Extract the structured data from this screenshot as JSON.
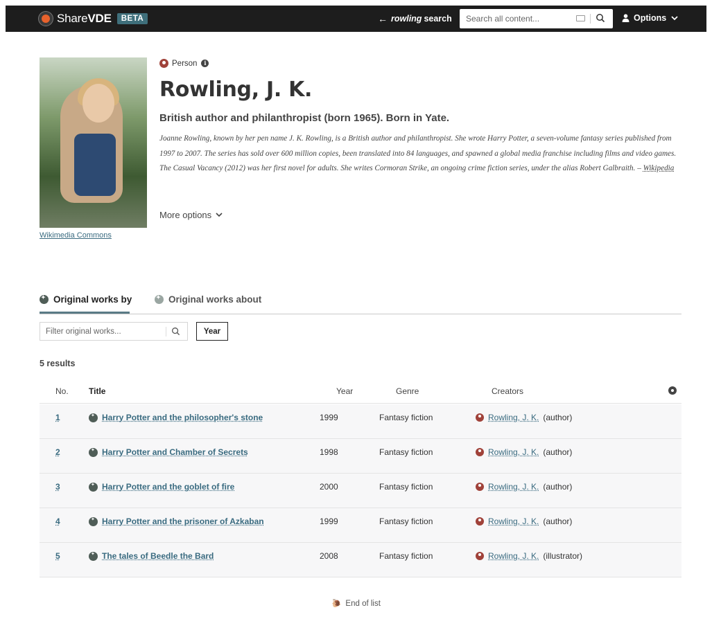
{
  "header": {
    "logo_light": "Share",
    "logo_bold": "VDE",
    "beta": "BETA",
    "back_query": "rowling",
    "back_rest": "search",
    "search_placeholder": "Search all content...",
    "options_label": "Options"
  },
  "person": {
    "type": "Person",
    "name": "Rowling, J. K.",
    "subtitle": "British author and philanthropist (born 1965). Born in Yate.",
    "bio": "Joanne Rowling, known by her pen name J. K. Rowling, is a British author and philanthropist. She wrote Harry Potter, a seven-volume fantasy series published from 1997 to 2007. The series has sold over 600 million copies, been translated into 84 languages, and spawned a global media franchise including films and video games. The Casual Vacancy (2012) was her first novel for adults. She writes Cormoran Strike, an ongoing crime fiction series, under the alias Robert Galbraith. – ",
    "bio_source": "Wikipedia",
    "more_options": "More options",
    "photo_credit": "Wikimedia Commons"
  },
  "tabs": [
    {
      "label": "Original works by"
    },
    {
      "label": "Original works about"
    }
  ],
  "filter": {
    "placeholder": "Filter original works...",
    "year_button": "Year"
  },
  "results_count": "5 results",
  "table": {
    "headers": {
      "no": "No.",
      "title": "Title",
      "year": "Year",
      "genre": "Genre",
      "creators": "Creators"
    },
    "rows": [
      {
        "no": "1",
        "title": "Harry Potter and the philosopher's stone",
        "year": "1999",
        "genre": "Fantasy fiction",
        "creator": "Rowling, J. K.",
        "role": "(author)"
      },
      {
        "no": "2",
        "title": "Harry Potter and Chamber of Secrets",
        "year": "1998",
        "genre": "Fantasy fiction",
        "creator": "Rowling, J. K.",
        "role": "(author)"
      },
      {
        "no": "3",
        "title": "Harry Potter and the goblet of fire",
        "year": "2000",
        "genre": "Fantasy fiction",
        "creator": "Rowling, J. K.",
        "role": "(author)"
      },
      {
        "no": "4",
        "title": "Harry Potter and the prisoner of Azkaban",
        "year": "1999",
        "genre": "Fantasy fiction",
        "creator": "Rowling, J. K.",
        "role": "(author)"
      },
      {
        "no": "5",
        "title": "The tales of Beedle the Bard",
        "year": "2008",
        "genre": "Fantasy fiction",
        "creator": "Rowling, J. K.",
        "role": "(illustrator)"
      }
    ]
  },
  "end_of_list": "End of list",
  "colors": {
    "accent": "#3a6b80",
    "brand_orange": "#e8622c",
    "person_red": "#a0423a",
    "topbar": "#1d1d1d"
  },
  "icons": [
    "logo-icon",
    "back-arrow-icon",
    "keyboard-icon",
    "search-icon",
    "user-icon",
    "chevron-down-icon",
    "person-icon",
    "info-icon",
    "work-icon",
    "gear-icon",
    "snail-icon"
  ]
}
